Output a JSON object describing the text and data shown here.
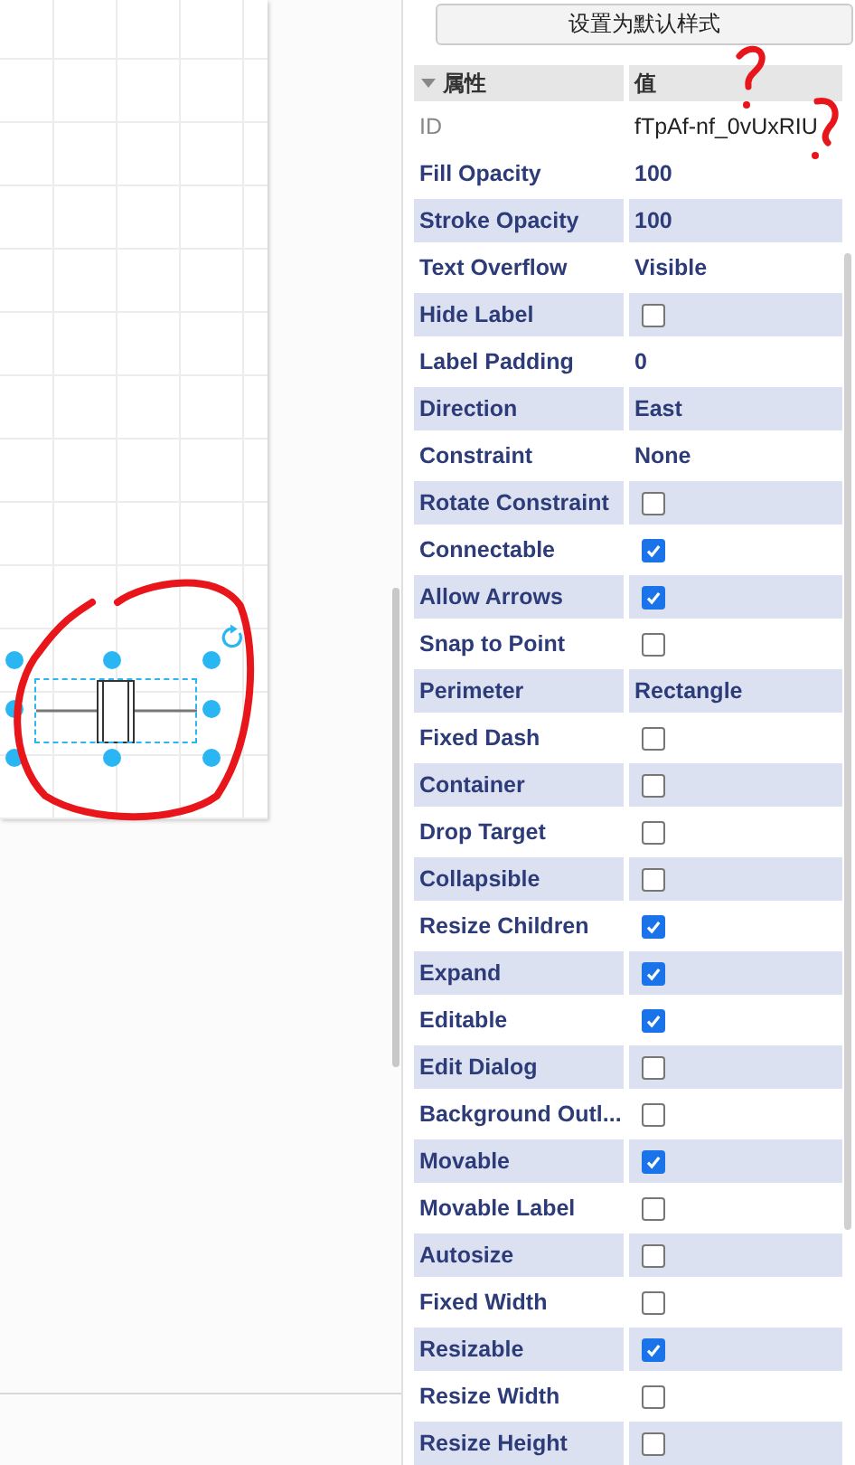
{
  "panel": {
    "button": "设置为默认样式",
    "columns": [
      "属性",
      "值"
    ],
    "header_expanded": true,
    "rows": [
      {
        "kind": "readonly",
        "label": "ID",
        "value": "fTpAf-nf_0vUxRIU"
      },
      {
        "kind": "text",
        "label": "Fill Opacity",
        "value": "100"
      },
      {
        "kind": "text",
        "label": "Stroke Opacity",
        "value": "100"
      },
      {
        "kind": "text",
        "label": "Text Overflow",
        "value": "Visible"
      },
      {
        "kind": "checkbox",
        "label": "Hide Label",
        "checked": false
      },
      {
        "kind": "text",
        "label": "Label Padding",
        "value": "0"
      },
      {
        "kind": "text",
        "label": "Direction",
        "value": "East"
      },
      {
        "kind": "text",
        "label": "Constraint",
        "value": "None"
      },
      {
        "kind": "checkbox",
        "label": "Rotate Constraint",
        "checked": false
      },
      {
        "kind": "checkbox",
        "label": "Connectable",
        "checked": true
      },
      {
        "kind": "checkbox",
        "label": "Allow Arrows",
        "checked": true
      },
      {
        "kind": "checkbox",
        "label": "Snap to Point",
        "checked": false
      },
      {
        "kind": "text",
        "label": "Perimeter",
        "value": "Rectangle"
      },
      {
        "kind": "checkbox",
        "label": "Fixed Dash",
        "checked": false
      },
      {
        "kind": "checkbox",
        "label": "Container",
        "checked": false
      },
      {
        "kind": "checkbox",
        "label": "Drop Target",
        "checked": false
      },
      {
        "kind": "checkbox",
        "label": "Collapsible",
        "checked": false
      },
      {
        "kind": "checkbox",
        "label": "Resize Children",
        "checked": true
      },
      {
        "kind": "checkbox",
        "label": "Expand",
        "checked": true
      },
      {
        "kind": "checkbox",
        "label": "Editable",
        "checked": true
      },
      {
        "kind": "checkbox",
        "label": "Edit Dialog",
        "checked": false
      },
      {
        "kind": "checkbox",
        "label": "Background Outl...",
        "checked": false
      },
      {
        "kind": "checkbox",
        "label": "Movable",
        "checked": true
      },
      {
        "kind": "checkbox",
        "label": "Movable Label",
        "checked": false
      },
      {
        "kind": "checkbox",
        "label": "Autosize",
        "checked": false
      },
      {
        "kind": "checkbox",
        "label": "Fixed Width",
        "checked": false
      },
      {
        "kind": "checkbox",
        "label": "Resizable",
        "checked": true
      },
      {
        "kind": "checkbox",
        "label": "Resize Width",
        "checked": false
      },
      {
        "kind": "checkbox",
        "label": "Resize Height",
        "checked": false
      }
    ]
  },
  "canvas": {
    "shape_selected": true
  }
}
